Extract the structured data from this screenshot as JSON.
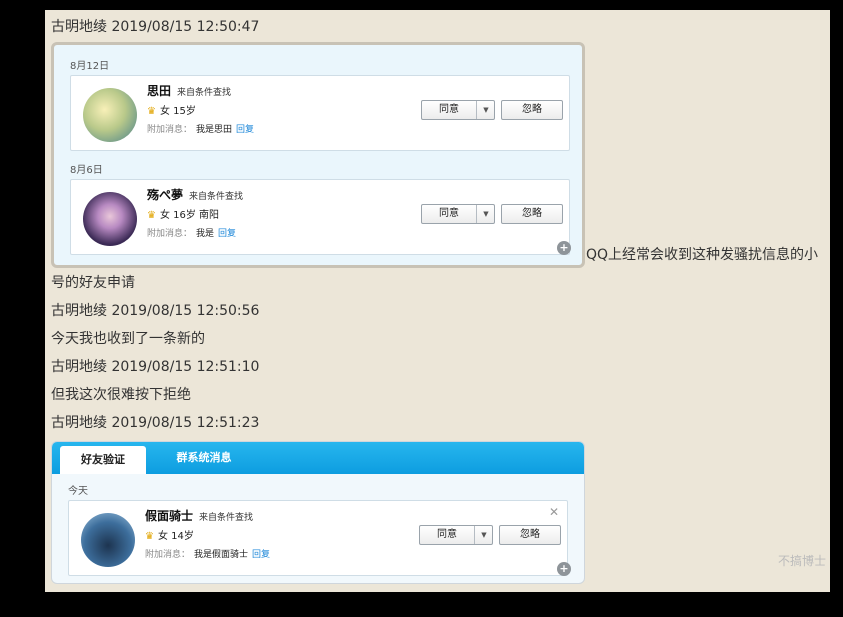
{
  "lines": {
    "l1": "古明地绫 2019/08/15 12:50:47",
    "l2_cont": "QQ上经常会收到这种发骚扰信息的小",
    "l3": "号的好友申请",
    "l4": "古明地绫 2019/08/15 12:50:56",
    "l5": "今天我也收到了一条新的",
    "l6": "古明地绫 2019/08/15 12:51:10",
    "l7": "但我这次很难按下拒绝",
    "l8": "古明地绫 2019/08/15 12:51:23"
  },
  "screenshot1": {
    "groups": [
      {
        "date": "8月12日",
        "request": {
          "name": "思田",
          "source": "来自条件查找",
          "info": "女 15岁",
          "msg_label": "附加消息：",
          "msg": "我是思田",
          "reply": "回复",
          "agree": "同意",
          "ignore": "忽略"
        }
      },
      {
        "date": "8月6日",
        "request": {
          "name": "殇ぺ夢",
          "source": "来自条件查找",
          "info": "女 16岁 南阳",
          "msg_label": "附加消息：",
          "msg": "我是",
          "reply": "回复",
          "agree": "同意",
          "ignore": "忽略"
        }
      }
    ]
  },
  "screenshot2": {
    "tabs": [
      "好友验证",
      "群系统消息"
    ],
    "date": "今天",
    "request": {
      "name": "假面骑士",
      "source": "来自条件查找",
      "info": "女 14岁",
      "msg_label": "附加消息：",
      "msg": "我是假面骑士",
      "reply": "回复",
      "agree": "同意",
      "ignore": "忽略"
    }
  },
  "watermark": "不搞博士",
  "icons": {
    "zoom_in": "zoom-in-icon",
    "crown": "crown-icon",
    "dropdown": "chevron-down-icon",
    "close": "close-icon"
  }
}
